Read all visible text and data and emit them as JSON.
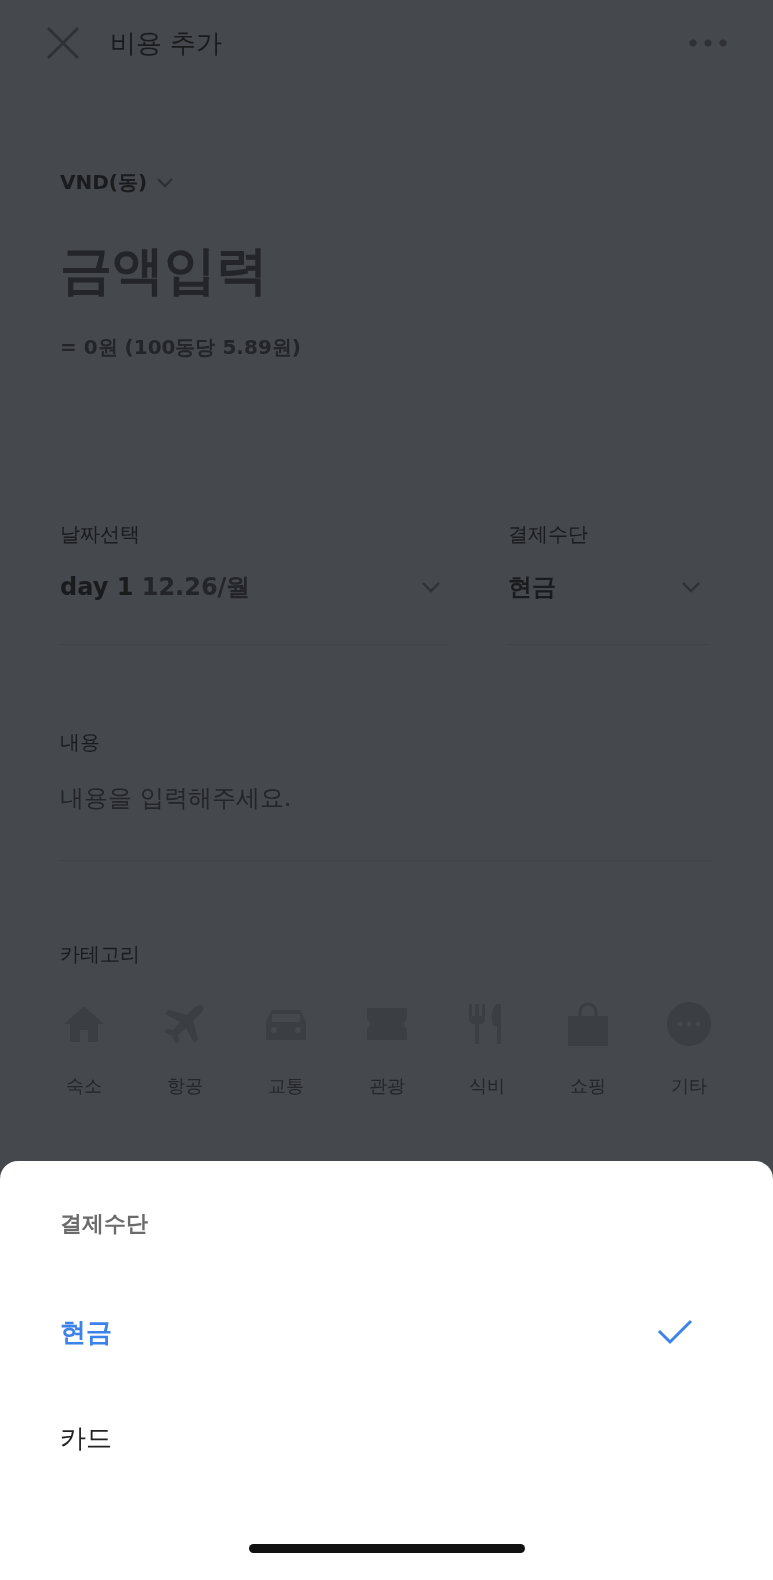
{
  "header": {
    "title": "비용 추가"
  },
  "currency": {
    "label": "VND(동)"
  },
  "amount": {
    "placeholder": "금액입력",
    "conversion": "= 0원 (100동당 5.89원)"
  },
  "date": {
    "label": "날짜선택",
    "day": "day 1",
    "date": "12.26/월"
  },
  "payment": {
    "label": "결제수단",
    "value": "현금"
  },
  "memo": {
    "label": "내용",
    "placeholder": "내용을 입력해주세요."
  },
  "category": {
    "label": "카테고리",
    "items": [
      {
        "label": "숙소",
        "kind": "home"
      },
      {
        "label": "항공",
        "kind": "plane"
      },
      {
        "label": "교통",
        "kind": "car"
      },
      {
        "label": "관광",
        "kind": "ticket"
      },
      {
        "label": "식비",
        "kind": "food"
      },
      {
        "label": "쇼핑",
        "kind": "bag"
      },
      {
        "label": "기타",
        "kind": "more"
      }
    ]
  },
  "sheet": {
    "title": "결제수단",
    "options": [
      {
        "label": "현금",
        "selected": true
      },
      {
        "label": "카드",
        "selected": false
      }
    ]
  }
}
